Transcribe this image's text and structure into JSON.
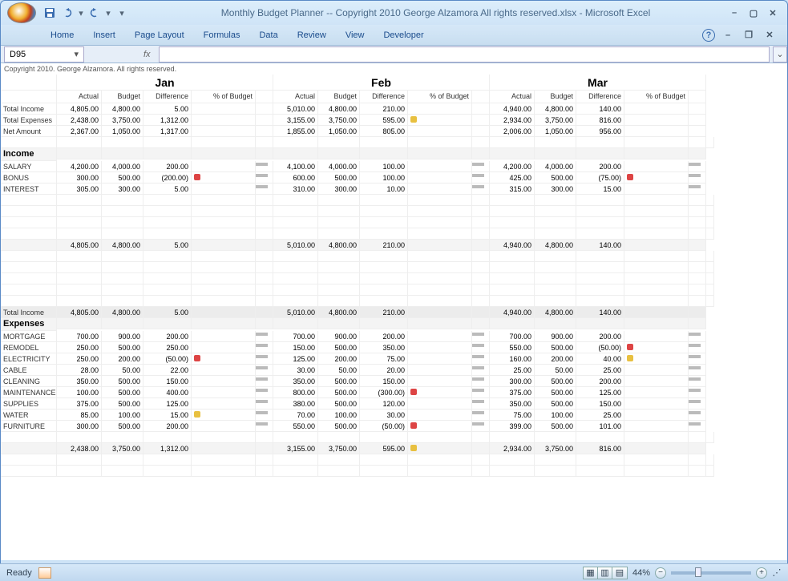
{
  "app": {
    "title": "Monthly Budget Planner -- Copyright 2010 George Alzamora  All rights reserved.xlsx - Microsoft Excel"
  },
  "tabs": [
    "Home",
    "Insert",
    "Page Layout",
    "Formulas",
    "Data",
    "Review",
    "View",
    "Developer"
  ],
  "namebox": "D95",
  "copyright": "Copyright 2010.  George Alzamora.  All rights reserved.",
  "months": [
    "Jan",
    "Feb",
    "Mar"
  ],
  "headers": [
    "Actual",
    "Budget",
    "Difference",
    "% of Budget"
  ],
  "summary_labels": [
    "Total Income",
    "Total Expenses",
    "Net Amount"
  ],
  "summary": [
    [
      [
        "4,805.00",
        "4,800.00",
        "5.00",
        ""
      ],
      [
        "5,010.00",
        "4,800.00",
        "210.00",
        ""
      ],
      [
        "4,940.00",
        "4,800.00",
        "140.00",
        ""
      ]
    ],
    [
      [
        "2,438.00",
        "3,750.00",
        "1,312.00",
        ""
      ],
      [
        "3,155.00",
        "3,750.00",
        "595.00",
        "y"
      ],
      [
        "2,934.00",
        "3,750.00",
        "816.00",
        ""
      ]
    ],
    [
      [
        "2,367.00",
        "1,050.00",
        "1,317.00",
        ""
      ],
      [
        "1,855.00",
        "1,050.00",
        "805.00",
        ""
      ],
      [
        "2,006.00",
        "1,050.00",
        "956.00",
        ""
      ]
    ]
  ],
  "income_title": "Income",
  "income_labels": [
    "SALARY",
    "BONUS",
    "INTEREST"
  ],
  "income": [
    [
      [
        "4,200.00",
        "4,000.00",
        "200.00",
        ""
      ],
      [
        "4,100.00",
        "4,000.00",
        "100.00",
        ""
      ],
      [
        "4,200.00",
        "4,000.00",
        "200.00",
        ""
      ]
    ],
    [
      [
        "300.00",
        "500.00",
        "(200.00)",
        "r"
      ],
      [
        "600.00",
        "500.00",
        "100.00",
        ""
      ],
      [
        "425.00",
        "500.00",
        "(75.00)",
        "r"
      ]
    ],
    [
      [
        "305.00",
        "300.00",
        "5.00",
        ""
      ],
      [
        "310.00",
        "300.00",
        "10.00",
        ""
      ],
      [
        "315.00",
        "300.00",
        "15.00",
        ""
      ]
    ]
  ],
  "income_subtotal": [
    [
      "4,805.00",
      "4,800.00",
      "5.00"
    ],
    [
      "5,010.00",
      "4,800.00",
      "210.00"
    ],
    [
      "4,940.00",
      "4,800.00",
      "140.00"
    ]
  ],
  "total_income_label": "Total Income",
  "total_income": [
    [
      "4,805.00",
      "4,800.00",
      "5.00"
    ],
    [
      "5,010.00",
      "4,800.00",
      "210.00"
    ],
    [
      "4,940.00",
      "4,800.00",
      "140.00"
    ]
  ],
  "expenses_title": "Expenses",
  "expense_labels": [
    "MORTGAGE",
    "REMODEL",
    "ELECTRICITY",
    "CABLE",
    "CLEANING",
    "MAINTENANCE",
    "SUPPLIES",
    "WATER",
    "FURNITURE"
  ],
  "expenses": [
    [
      [
        "700.00",
        "900.00",
        "200.00",
        ""
      ],
      [
        "700.00",
        "900.00",
        "200.00",
        ""
      ],
      [
        "700.00",
        "900.00",
        "200.00",
        ""
      ]
    ],
    [
      [
        "250.00",
        "500.00",
        "250.00",
        ""
      ],
      [
        "150.00",
        "500.00",
        "350.00",
        ""
      ],
      [
        "550.00",
        "500.00",
        "(50.00)",
        "r"
      ]
    ],
    [
      [
        "250.00",
        "200.00",
        "(50.00)",
        "r"
      ],
      [
        "125.00",
        "200.00",
        "75.00",
        ""
      ],
      [
        "160.00",
        "200.00",
        "40.00",
        "y"
      ]
    ],
    [
      [
        "28.00",
        "50.00",
        "22.00",
        ""
      ],
      [
        "30.00",
        "50.00",
        "20.00",
        ""
      ],
      [
        "25.00",
        "50.00",
        "25.00",
        ""
      ]
    ],
    [
      [
        "350.00",
        "500.00",
        "150.00",
        ""
      ],
      [
        "350.00",
        "500.00",
        "150.00",
        ""
      ],
      [
        "300.00",
        "500.00",
        "200.00",
        ""
      ]
    ],
    [
      [
        "100.00",
        "500.00",
        "400.00",
        ""
      ],
      [
        "800.00",
        "500.00",
        "(300.00)",
        "r"
      ],
      [
        "375.00",
        "500.00",
        "125.00",
        ""
      ]
    ],
    [
      [
        "375.00",
        "500.00",
        "125.00",
        ""
      ],
      [
        "380.00",
        "500.00",
        "120.00",
        ""
      ],
      [
        "350.00",
        "500.00",
        "150.00",
        ""
      ]
    ],
    [
      [
        "85.00",
        "100.00",
        "15.00",
        "y"
      ],
      [
        "70.00",
        "100.00",
        "30.00",
        ""
      ],
      [
        "75.00",
        "100.00",
        "25.00",
        ""
      ]
    ],
    [
      [
        "300.00",
        "500.00",
        "200.00",
        ""
      ],
      [
        "550.00",
        "500.00",
        "(50.00)",
        "r"
      ],
      [
        "399.00",
        "500.00",
        "101.00",
        ""
      ]
    ]
  ],
  "expense_subtotal": [
    [
      "2,438.00",
      "3,750.00",
      "1,312.00",
      ""
    ],
    [
      "3,155.00",
      "3,750.00",
      "595.00",
      "y"
    ],
    [
      "2,934.00",
      "3,750.00",
      "816.00",
      ""
    ]
  ],
  "status": {
    "ready": "Ready",
    "zoom": "44%"
  }
}
